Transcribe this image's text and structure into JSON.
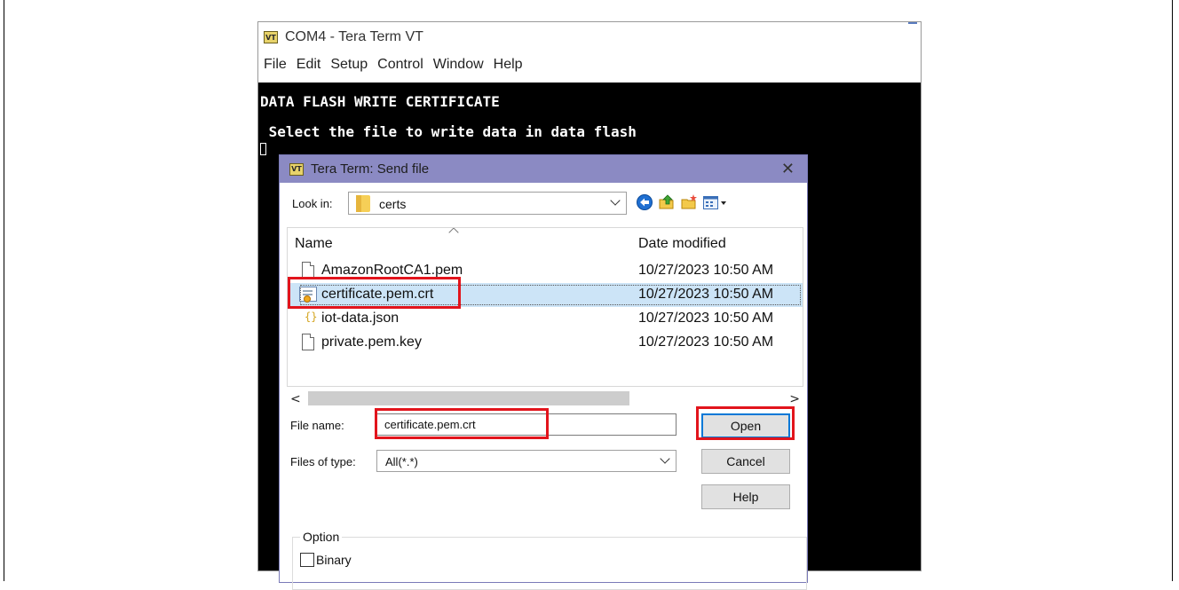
{
  "window": {
    "title": "COM4 - Tera Term VT",
    "app_icon_text": "VT",
    "menu": [
      "File",
      "Edit",
      "Setup",
      "Control",
      "Window",
      "Help"
    ]
  },
  "terminal": {
    "lines": [
      "DATA FLASH WRITE CERTIFICATE",
      " Select the file to write data in data flash"
    ]
  },
  "dialog": {
    "title": "Tera Term: Send file",
    "icon_text": "VT",
    "look_in_label": "Look in:",
    "look_in_value": "certs",
    "toolbar_icons": [
      "back-icon",
      "up-folder-icon",
      "new-folder-icon",
      "view-menu-icon"
    ],
    "columns": {
      "name": "Name",
      "date": "Date modified"
    },
    "files": [
      {
        "name": "AmazonRootCA1.pem",
        "date": "10/27/2023 10:50 AM",
        "icon": "document-icon"
      },
      {
        "name": "certificate.pem.crt",
        "date": "10/27/2023 10:50 AM",
        "icon": "certificate-icon",
        "selected": true
      },
      {
        "name": "iot-data.json",
        "date": "10/27/2023 10:50 AM",
        "icon": "json-file-icon"
      },
      {
        "name": "private.pem.key",
        "date": "10/27/2023 10:50 AM",
        "icon": "document-icon"
      }
    ],
    "file_name_label": "File name:",
    "file_name_value": "certificate.pem.crt",
    "file_type_label": "Files of type:",
    "file_type_value": "All(*.*)",
    "buttons": {
      "open": "Open",
      "cancel": "Cancel",
      "help": "Help"
    },
    "option_group": {
      "label": "Option",
      "binary_label": "Binary",
      "binary_checked": false
    }
  },
  "colors": {
    "highlight": "#e2141c",
    "dialog_titlebar": "#8b8ac3",
    "selection": "#cce4f7",
    "terminal_bg": "#000000"
  }
}
